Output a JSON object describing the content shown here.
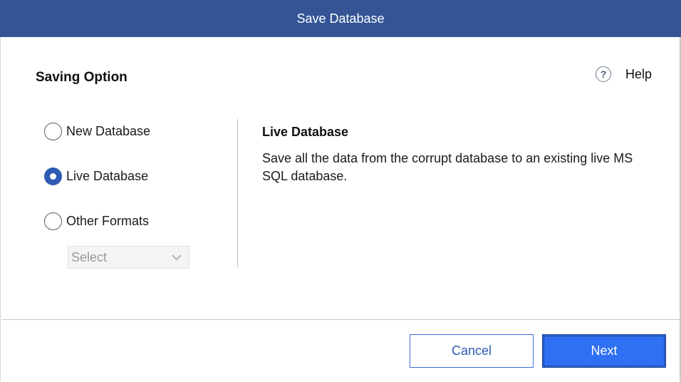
{
  "window": {
    "title": "Save Database"
  },
  "section": {
    "title": "Saving Option"
  },
  "help": {
    "label": "Help",
    "icon": "question-circle-icon"
  },
  "options": [
    {
      "label": "New Database",
      "checked": false
    },
    {
      "label": "Live Database",
      "checked": true
    },
    {
      "label": "Other Formats",
      "checked": false
    }
  ],
  "format_select": {
    "value": "Select",
    "enabled": false
  },
  "description": {
    "title": "Live Database",
    "text": "Save all the data from the corrupt database to an existing live MS SQL database."
  },
  "buttons": {
    "cancel": "Cancel",
    "next": "Next"
  },
  "colors": {
    "titlebar": "#345496",
    "accent": "#2f5bb3",
    "primary_button": "#2f6ff2"
  }
}
